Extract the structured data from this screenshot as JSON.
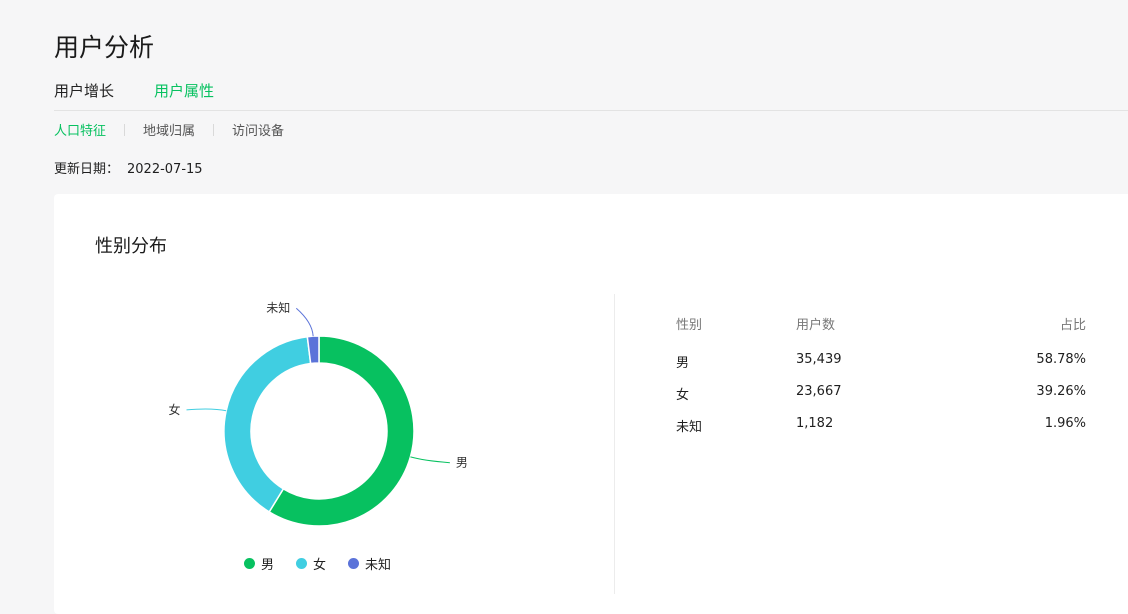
{
  "page": {
    "title": "用户分析"
  },
  "tabs": [
    {
      "label": "用户增长",
      "active": false
    },
    {
      "label": "用户属性",
      "active": true
    }
  ],
  "subtabs": [
    {
      "label": "人口特征",
      "active": true
    },
    {
      "label": "地域归属",
      "active": false
    },
    {
      "label": "访问设备",
      "active": false
    }
  ],
  "update": {
    "label": "更新日期：",
    "date": "2022-07-15"
  },
  "card": {
    "title": "性别分布"
  },
  "table": {
    "headers": [
      "性别",
      "用户数",
      "占比"
    ],
    "rows": [
      [
        "男",
        "35,439",
        "58.78%"
      ],
      [
        "女",
        "23,667",
        "39.26%"
      ],
      [
        "未知",
        "1,182",
        "1.96%"
      ]
    ]
  },
  "colors": {
    "accent": "#07c160",
    "male": "#07c160",
    "female": "#40cee1",
    "unknown": "#5b73d9"
  },
  "chart_data": {
    "type": "pie",
    "variant": "donut",
    "title": "性别分布",
    "categories": [
      "男",
      "女",
      "未知"
    ],
    "values": [
      35439,
      23667,
      1182
    ],
    "legend": {
      "position": "bottom",
      "entries": [
        "男",
        "女",
        "未知"
      ]
    }
  }
}
